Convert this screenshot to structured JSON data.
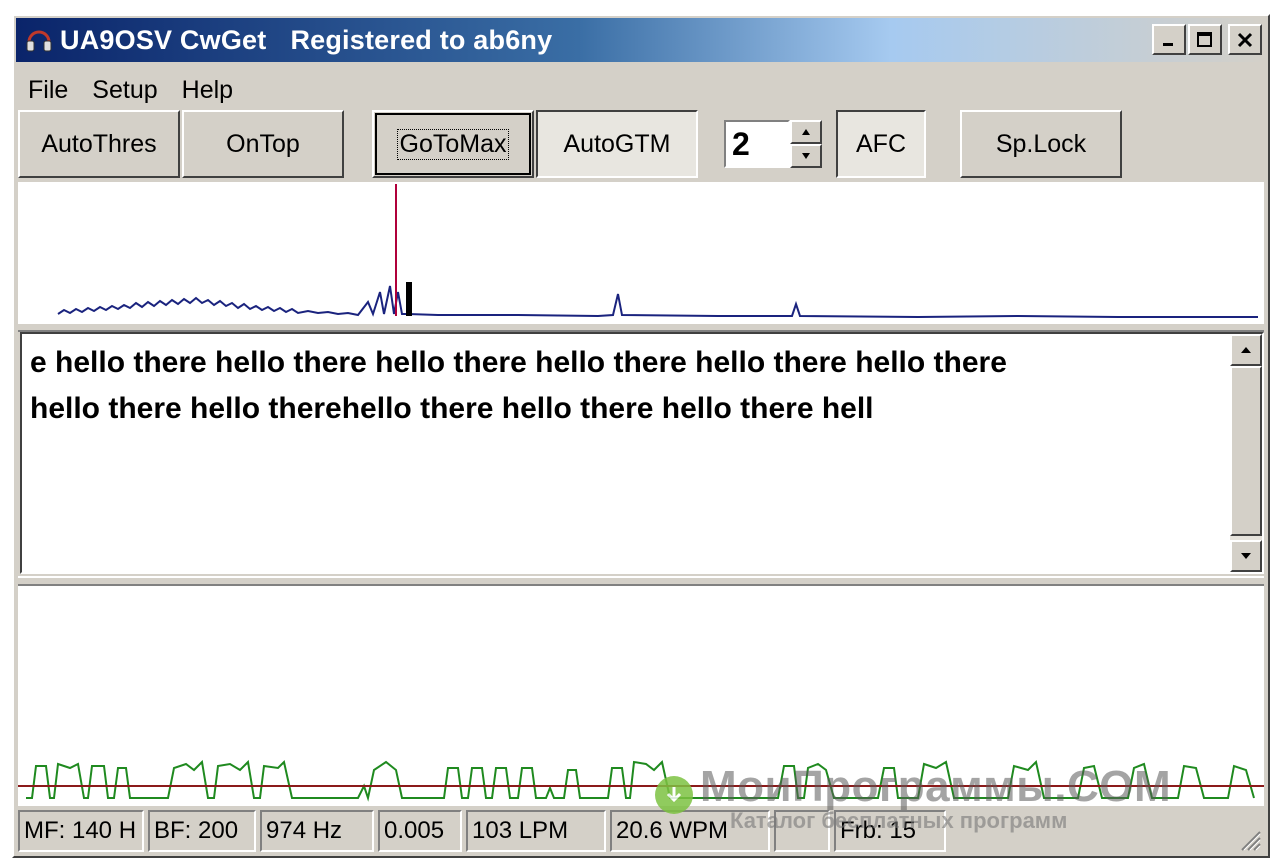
{
  "titlebar": {
    "app_name": "UA9OSV CwGet",
    "registration": "Registered to ab6ny",
    "minimize_icon": "minimize-icon",
    "maximize_icon": "maximize-icon",
    "close_icon": "close-icon"
  },
  "menu": [
    {
      "label": "File"
    },
    {
      "label": "Setup"
    },
    {
      "label": "Help"
    }
  ],
  "toolbar": {
    "auto_thres": "AutoThres",
    "on_top": "OnTop",
    "go_to_max": "GoToMax",
    "auto_gtm": "AutoGTM",
    "spin_value": "2",
    "afc": "AFC",
    "sp_lock": "Sp.Lock"
  },
  "decoded_text": {
    "line1": "e hello there hello there hello there hello there hello there hello there",
    "line2": "hello there hello therehello there hello there hello there hell"
  },
  "status": {
    "mf": "MF: 140 H",
    "bf": "BF: 200",
    "freq": "974 Hz",
    "level": "0.005",
    "lpm": "103 LPM",
    "wpm": "20.6 WPM",
    "empty": "",
    "frb": "Frb: 15"
  },
  "watermark": {
    "title": "МоиПрограммы.COM",
    "subtitle": "Каталог бесплатных программ"
  },
  "colors": {
    "titlebar_start": "#0a246a",
    "spectrum_line": "#1a237e",
    "peak_marker": "#b0003a",
    "signal_line": "#1f8a1f",
    "threshold_line": "#8b1a1a"
  }
}
